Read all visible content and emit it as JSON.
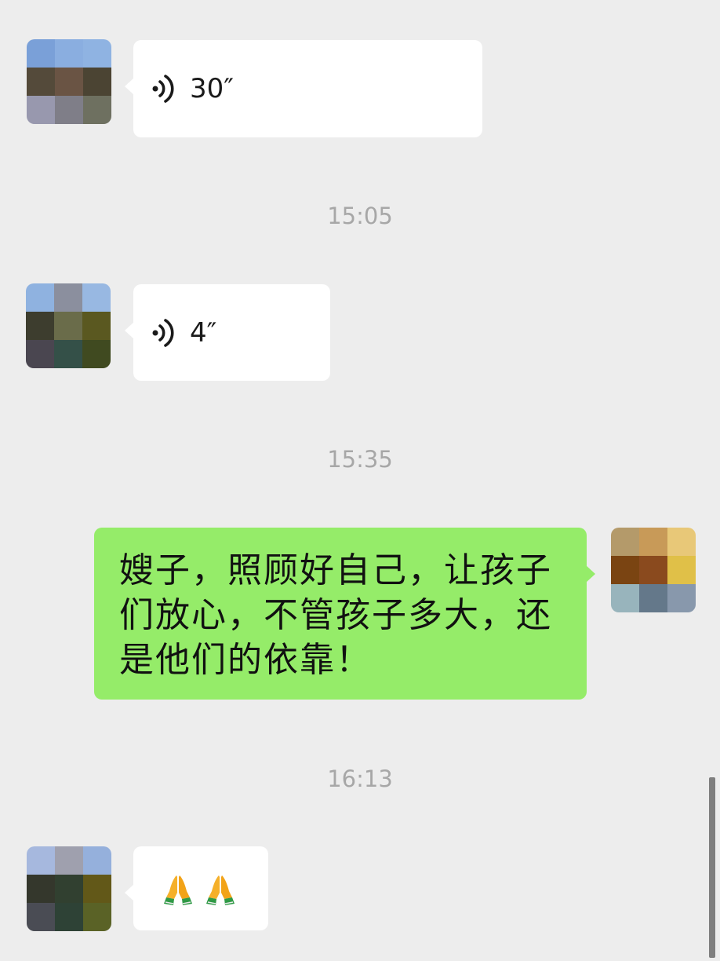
{
  "colors": {
    "background": "#ededed",
    "incoming_bubble": "#ffffff",
    "outgoing_bubble": "#95ec69",
    "timestamp": "#a7a7a7"
  },
  "messages": {
    "voice1": {
      "duration": "30″",
      "icon": "voice-wave-icon"
    },
    "time1": "15:05",
    "voice2": {
      "duration": "4″",
      "icon": "voice-wave-icon"
    },
    "time2": "15:35",
    "text1": "嫂子，照顾好自己，让孩子们放心，不管孩子多大，还是他们的依靠！",
    "time3": "16:13",
    "emoji1": {
      "icons": [
        "folded-hands-emoji",
        "folded-hands-emoji"
      ]
    }
  }
}
